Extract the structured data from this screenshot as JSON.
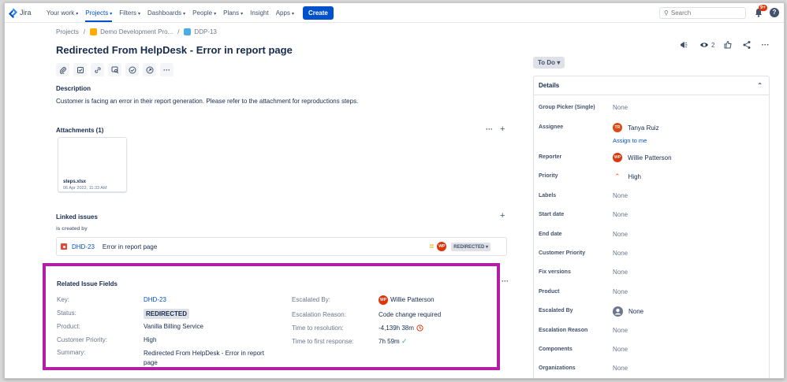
{
  "nav": {
    "logo": "Jira",
    "items": [
      {
        "label": "Your work",
        "caret": true,
        "active": false
      },
      {
        "label": "Projects",
        "caret": true,
        "active": true
      },
      {
        "label": "Filters",
        "caret": true,
        "active": false
      },
      {
        "label": "Dashboards",
        "caret": true,
        "active": false
      },
      {
        "label": "People",
        "caret": true,
        "active": false
      },
      {
        "label": "Plans",
        "caret": true,
        "active": false
      },
      {
        "label": "Insight",
        "caret": false,
        "active": false
      },
      {
        "label": "Apps",
        "caret": true,
        "active": false
      }
    ],
    "create_label": "Create",
    "search_placeholder": "Search",
    "notifications_badge": "9+",
    "help_label": "?"
  },
  "breadcrumb": {
    "projects": "Projects",
    "sep": "/",
    "project": "Demo Development Pro...",
    "issue": "DDP-13"
  },
  "issue": {
    "title": "Redirected From HelpDesk - Error in report page",
    "description_heading": "Description",
    "description": "Customer is facing an error in their report generation. Please refer to the attachment for reproductions steps."
  },
  "attachments": {
    "heading": "Attachments (1)",
    "file_name": "steps.xlsx",
    "file_date": "06 Apr 2022, 11:33 AM",
    "more": "···",
    "add": "+"
  },
  "linked": {
    "heading": "Linked issues",
    "relation": "is created by",
    "add": "+",
    "item": {
      "key": "DHD-23",
      "summary": "Error in report page",
      "avatar": "WP",
      "status": "REDIRECTED"
    }
  },
  "related": {
    "heading": "Related Issue Fields",
    "left": [
      {
        "label": "Key:",
        "value": "DHD-23"
      },
      {
        "label": "Status:",
        "value": "REDIRECTED"
      },
      {
        "label": "Product:",
        "value": "Vanilla Billing Service"
      },
      {
        "label": "Customer Priority:",
        "value": "High"
      },
      {
        "label": "Summary:",
        "value": "Redirected From HelpDesk - Error in report page"
      }
    ],
    "right": [
      {
        "label": "Escalated By:",
        "value": "Willie Patterson",
        "avatar": "WP"
      },
      {
        "label": "Escalation Reason:",
        "value": "Code change required"
      },
      {
        "label": "Time to resolution:",
        "value": "-4,139h 38m"
      },
      {
        "label": "Time to first response:",
        "value": "7h 59m"
      }
    ],
    "more": "···"
  },
  "header_actions": {
    "watchers": "2",
    "more": "···"
  },
  "status_button": "To Do",
  "details": {
    "heading": "Details",
    "fields": [
      {
        "label": "Group Picker (Single)",
        "value": "None"
      },
      {
        "label": "Assignee",
        "value": "Tanya Ruiz",
        "avatar": "TR",
        "assign_to_me": "Assign to me"
      },
      {
        "label": "Reporter",
        "value": "Willie Patterson",
        "avatar": "WP"
      },
      {
        "label": "Priority",
        "value": "High"
      },
      {
        "label": "Labels",
        "value": "None"
      },
      {
        "label": "Start date",
        "value": "None"
      },
      {
        "label": "End date",
        "value": "None"
      },
      {
        "label": "Customer Priority",
        "value": "None"
      },
      {
        "label": "Fix versions",
        "value": "None"
      },
      {
        "label": "Product",
        "value": "None"
      },
      {
        "label": "Escalated By",
        "value": "None"
      },
      {
        "label": "Escalation Reason",
        "value": "None"
      },
      {
        "label": "Components",
        "value": "None"
      },
      {
        "label": "Organizations",
        "value": "None"
      }
    ]
  },
  "colors": {
    "accent": "#0052cc",
    "highlight_border": "#b31fa6",
    "avatar_red": "#de350b",
    "avatar_tr": "#de4a16",
    "priority_high": "#ff5630"
  }
}
